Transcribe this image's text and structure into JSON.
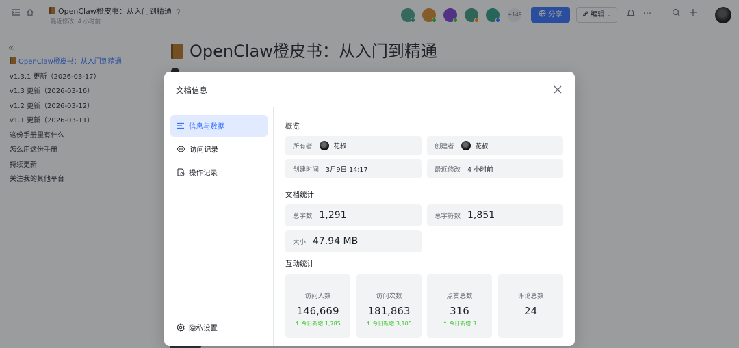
{
  "topbar": {
    "doc_title": "OpenClaw橙皮书：从入门到精通",
    "last_modified": "最近修改: 4 小时前",
    "more_viewers": "+149",
    "share_label": "分享",
    "edit_label": "编辑"
  },
  "colors": {
    "accent": "#3370ff",
    "active_nav_bg": "#e1eaff",
    "increase_green": "#34c724",
    "avatar_1": "#4aa08a",
    "avatar_2": "#d88b2b",
    "avatar_3": "#7a3fd0",
    "avatar_4": "#3f9a7d",
    "avatar_5": "#2f9a83"
  },
  "document": {
    "title": "OpenClaw橙皮书：从入门到精通",
    "toc": [
      "OpenClaw橙皮书：从入门到精通",
      "v1.3.1 更新（2026-03-17）",
      "v1.3 更新（2026-03-16）",
      "v1.2 更新（2026-03-12）",
      "v1.1 更新（2026-03-11）",
      "这份手册里有什么",
      "怎么用这份手册",
      "持续更新",
      "关注我的其他平台"
    ]
  },
  "dialog": {
    "title": "文档信息",
    "nav": {
      "info": "信息与数据",
      "visits": "访问记录",
      "operations": "操作记录",
      "privacy": "隐私设置"
    },
    "overview": {
      "title": "概览",
      "owner_label": "所有者",
      "owner_name": "花叔",
      "creator_label": "创建者",
      "creator_name": "花叔",
      "created_label": "创建时间",
      "created_value": "3月9日 14:17",
      "modified_label": "最近修改",
      "modified_value": "4 小时前"
    },
    "doc_stats": {
      "title": "文档统计",
      "words_label": "总字数",
      "words_value": "1,291",
      "chars_label": "总字符数",
      "chars_value": "1,851",
      "size_label": "大小",
      "size_value": "47.94 MB"
    },
    "interaction": {
      "title": "互动统计",
      "visitors_label": "访问人数",
      "visitors_value": "146,669",
      "visitors_today": "↑ 今日新增 1,785",
      "visits_label": "访问次数",
      "visits_value": "181,863",
      "visits_today": "↑ 今日新增 3,105",
      "likes_label": "点赞总数",
      "likes_value": "316",
      "likes_today": "↑ 今日新增 3",
      "comments_label": "评论总数",
      "comments_value": "24"
    }
  }
}
